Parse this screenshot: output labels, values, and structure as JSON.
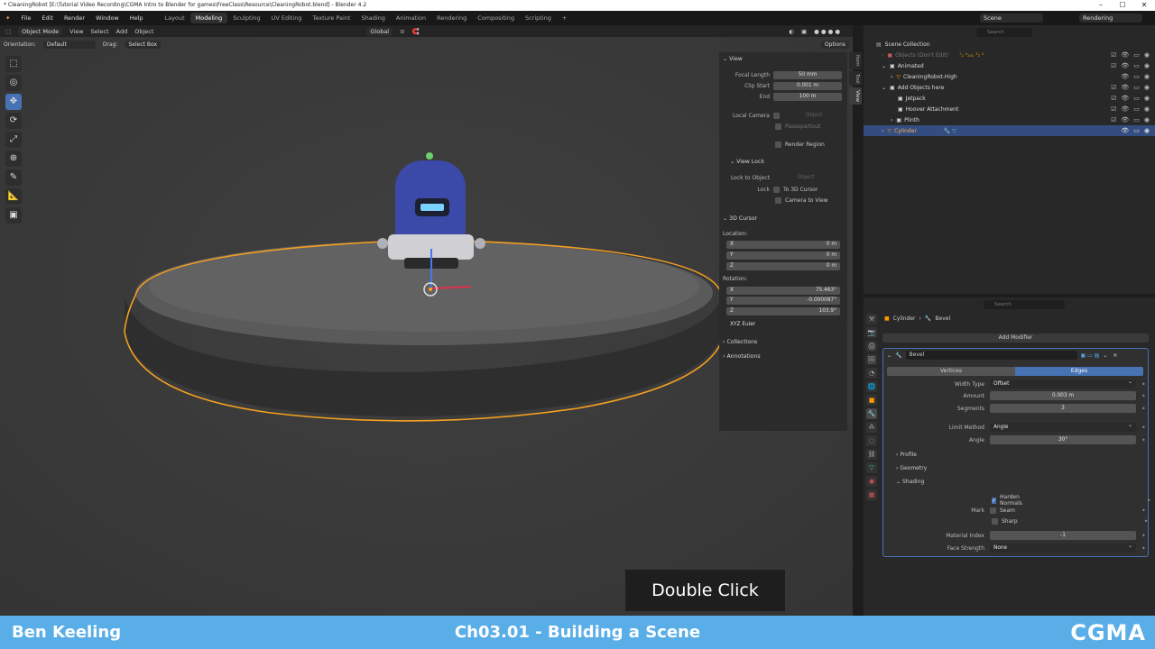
{
  "window": {
    "title": "* CleaningRobot [E:\\Tutorial Video Recording\\CGMA Intro to Blender for games\\FreeClass\\Resource\\CleaningRobot.blend] - Blender 4.2",
    "minimize": "–",
    "maximize": "☐",
    "close": "✕"
  },
  "menu": [
    "File",
    "Edit",
    "Render",
    "Window",
    "Help"
  ],
  "workspaces": [
    "Layout",
    "Modeling",
    "Sculpting",
    "UV Editing",
    "Texture Paint",
    "Shading",
    "Animation",
    "Rendering",
    "Compositing",
    "Scripting",
    "+"
  ],
  "active_workspace": "Modeling",
  "scene": {
    "label": "Scene",
    "view_layer": "Rendering"
  },
  "viewport_header": {
    "mode": "Object Mode",
    "menus": [
      "View",
      "Select",
      "Add",
      "Object"
    ],
    "transform": "Global",
    "orientation_label": "Orientation:",
    "orientation_value": "Default",
    "drag_label": "Drag:",
    "drag_value": "Select Box",
    "options": "Options"
  },
  "npanel": {
    "view_title": "View",
    "focal_length_label": "Focal Length",
    "focal_length": "50 mm",
    "clip_start_label": "Clip Start",
    "clip_start": "0.001 m",
    "end_label": "End",
    "end": "100 m",
    "local_camera_label": "Local Camera",
    "local_camera_placeholder": "Object",
    "passepartout": "Passepartout",
    "render_region": "Render Region",
    "view_lock_title": "View Lock",
    "lock_to_object_label": "Lock to Object",
    "lock_to_object_placeholder": "Object",
    "lock_label": "Lock",
    "to_3d_cursor": "To 3D Cursor",
    "camera_to_view": "Camera to View",
    "cursor_title": "3D Cursor",
    "location_label": "Location:",
    "loc_x_label": "X",
    "loc_x": "0 m",
    "loc_y_label": "Y",
    "loc_y": "0 m",
    "loc_z_label": "Z",
    "loc_z": "0 m",
    "rotation_label": "Rotation:",
    "rot_x_label": "X",
    "rot_x": "75.463°",
    "rot_y_label": "Y",
    "rot_y": "-0.000087°",
    "rot_z_label": "Z",
    "rot_z": "103.9°",
    "rotation_mode": "XYZ Euler",
    "collections": "Collections",
    "annotations": "Annotations",
    "tabs": [
      "Item",
      "Tool",
      "View"
    ]
  },
  "outliner": {
    "search_placeholder": "Search",
    "root": "Scene Collection",
    "items": [
      {
        "label": "Objects (Don't Edit)",
        "extra": "⁷₂ ⁵₂₄₁ ³₂ ²"
      },
      {
        "label": "Animated",
        "extra": ""
      },
      {
        "label": "CleaningRobot-High",
        "extra": ""
      },
      {
        "label": "Add Objects here",
        "extra": ""
      },
      {
        "label": "Jetpack",
        "extra": ""
      },
      {
        "label": "Hoover Attachment",
        "extra": ""
      },
      {
        "label": "Plinth",
        "extra": ""
      },
      {
        "label": "Cylinder",
        "extra": ""
      }
    ]
  },
  "properties": {
    "search_placeholder": "Search",
    "breadcrumb_object": "Cylinder",
    "breadcrumb_modifier": "Bevel",
    "add_modifier": "Add Modifier",
    "modifier_name": "Bevel",
    "affect_vertices": "Vertices",
    "affect_edges": "Edges",
    "width_type_label": "Width Type",
    "width_type": "Offset",
    "amount_label": "Amount",
    "amount": "0.003 m",
    "segments_label": "Segments",
    "segments": "3",
    "limit_method_label": "Limit Method",
    "limit_method": "Angle",
    "angle_label": "Angle",
    "angle": "30°",
    "profile": "Profile",
    "geometry": "Geometry",
    "shading": "Shading",
    "harden_normals": "Harden Normals",
    "mark_label": "Mark",
    "seam": "Seam",
    "sharp": "Sharp",
    "material_index_label": "Material Index",
    "material_index": "-1",
    "face_strength_label": "Face Strength",
    "face_strength": "None"
  },
  "caption": "Double Click",
  "footer": {
    "name": "Ben Keeling",
    "chapter": "Ch03.01 - Building a Scene",
    "logo": "CGMA"
  },
  "colors": {
    "accent": "#4772b3",
    "selection_outline": "#f5a020",
    "footer_bg": "#5aaee8",
    "robot_blue": "#3b4aa8"
  }
}
